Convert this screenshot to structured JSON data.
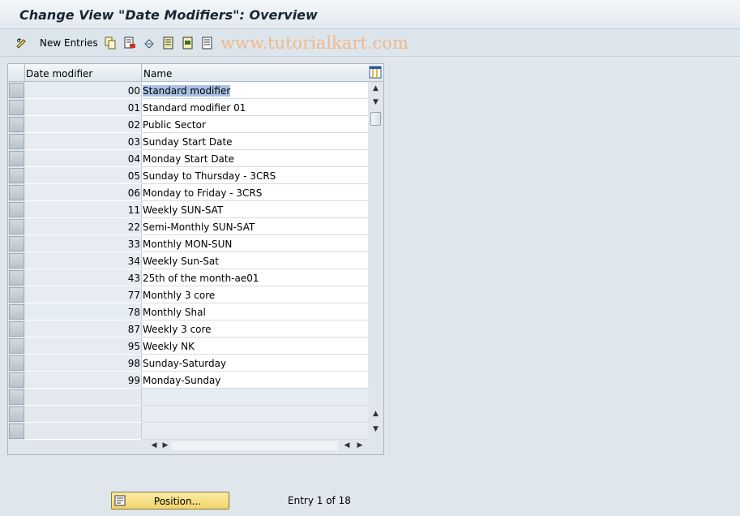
{
  "window": {
    "title": "Change View \"Date Modifiers\": Overview"
  },
  "toolbar": {
    "new_entries_label": "New Entries",
    "icons": [
      "edit-glasses-icon",
      "copy-icon",
      "delete-icon",
      "undo-icon",
      "select-all-icon",
      "select-block-icon",
      "deselect-all-icon"
    ]
  },
  "watermark": "www.tutorialkart.com",
  "table": {
    "columns": [
      "Date modifier",
      "Name"
    ],
    "rows": [
      {
        "modifier": "00",
        "name": "Standard modifier"
      },
      {
        "modifier": "01",
        "name": "Standard modifier 01"
      },
      {
        "modifier": "02",
        "name": "Public Sector"
      },
      {
        "modifier": "03",
        "name": "Sunday Start Date"
      },
      {
        "modifier": "04",
        "name": "Monday Start Date"
      },
      {
        "modifier": "05",
        "name": "Sunday to Thursday - 3CRS"
      },
      {
        "modifier": "06",
        "name": "Monday to Friday - 3CRS"
      },
      {
        "modifier": "11",
        "name": "Weekly SUN-SAT"
      },
      {
        "modifier": "22",
        "name": "Semi-Monthly SUN-SAT"
      },
      {
        "modifier": "33",
        "name": "Monthly MON-SUN"
      },
      {
        "modifier": "34",
        "name": "Weekly Sun-Sat"
      },
      {
        "modifier": "43",
        "name": "25th of the month-ae01"
      },
      {
        "modifier": "77",
        "name": "Monthly 3 core"
      },
      {
        "modifier": "78",
        "name": "Monthly Shal"
      },
      {
        "modifier": "87",
        "name": "Weekly 3 core"
      },
      {
        "modifier": "95",
        "name": "Weekly NK"
      },
      {
        "modifier": "98",
        "name": "Sunday-Saturday"
      },
      {
        "modifier": "99",
        "name": "Monday-Sunday"
      }
    ],
    "empty_rows": 3
  },
  "footer": {
    "position_button_label": "Position...",
    "entry_info": "Entry 1 of 18"
  },
  "colors": {
    "selection_highlight": "#a9c1e4",
    "position_button": "#f2d56a",
    "watermark": "#efb98a"
  }
}
